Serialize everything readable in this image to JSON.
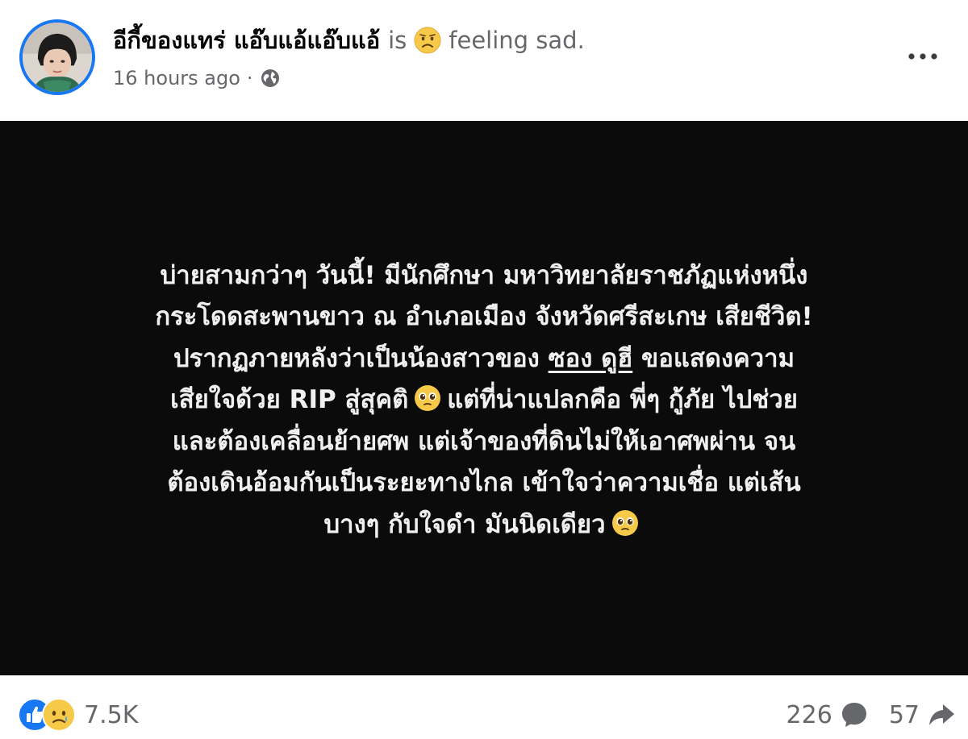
{
  "post": {
    "author_name": "อีกี้ของแทร่ แอ๊บแอ้แอ๊บแอ้",
    "is_word": "is",
    "feeling_emoji": "sad-face-icon",
    "feeling": "feeling sad.",
    "timestamp": "16 hours ago",
    "separator": "·",
    "audience_icon": "globe-icon",
    "body_lines": [
      "บ่ายสามกว่าๆ วันนี้! มีนักศึกษา มหาวิทยาลัยราชภัฏแห่งหนึ่ง",
      "กระโดดสะพานขาว ณ อำเภอเมือง จังหวัดศรีสะเกษ เสียชีวิต!",
      "ปรากฏภายหลังว่าเป็นน้องสาวของ",
      "ขอแสดงความ",
      "เสียใจด้วย RIP สู่สุคติ",
      "แต่ที่น่าแปลกคือ พี่ๆ กู้ภัย ไปช่วย",
      "และต้องเคลื่อนย้ายศพ แต่เจ้าของที่ดินไม่ให้เอาศพผ่าน จน",
      "ต้องเดินอ้อมกันเป็นระยะทางไกล เข้าใจว่าความเชื่อ แต่เส้น",
      "บางๆ กับใจดำ มันนิดเดียว"
    ],
    "mention": "ซอง ดูฮี",
    "inline_emoji": "teary-face-icon"
  },
  "footer": {
    "reaction_icons": [
      "like-icon",
      "sad-reaction-icon"
    ],
    "reaction_count": "7.5K",
    "comment_count": "226",
    "share_count": "57"
  },
  "colors": {
    "accent": "#1877f2",
    "content_bg": "#0b0b0b",
    "secondary_text": "#65676b",
    "emoji_yellow": "#f7c948"
  }
}
